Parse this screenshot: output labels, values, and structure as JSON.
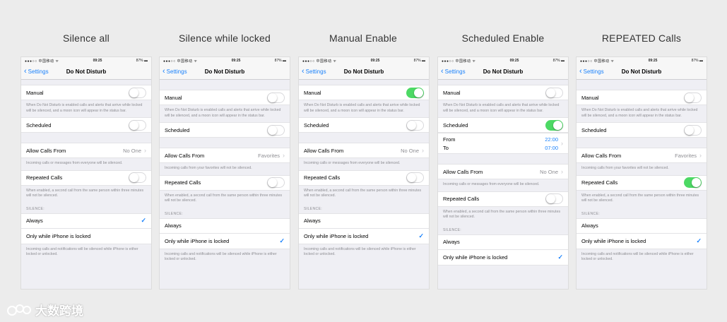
{
  "variants": [
    {
      "title": "Silence all"
    },
    {
      "title": "Silence while locked"
    },
    {
      "title": "Manual Enable"
    },
    {
      "title": "Scheduled Enable"
    },
    {
      "title": "REPEATED Calls"
    }
  ],
  "status_bar": {
    "carrier": "●●●○○ 中国移动 ᯤ",
    "time": "09:25",
    "battery": "87% ▬"
  },
  "nav": {
    "back_label": "Settings",
    "title": "Do Not Disturb"
  },
  "manual": {
    "label": "Manual",
    "note": "When Do Not Disturb is enabled calls and alerts that arrive while locked will be silenced, and a moon icon will appear in the status bar."
  },
  "scheduled": {
    "label": "Scheduled",
    "from_label": "From",
    "to_label": "To",
    "from_time": "22:00",
    "to_time": "07:00"
  },
  "allow_calls": {
    "label": "Allow Calls From",
    "value_no_one": "No One",
    "value_favorites": "Favorites",
    "note_everyone": "Incoming calls or messages from everyone will be silenced.",
    "note_favorites": "Incoming calls from your favorites will not be silenced."
  },
  "repeated": {
    "label": "Repeated Calls",
    "note": "When enabled, a second call from the same person within three minutes will not be silenced."
  },
  "silence": {
    "header": "SILENCE:",
    "always": "Always",
    "locked": "Only while iPhone is locked",
    "note": "Incoming calls and notifications will be silenced while iPhone is either locked or unlocked."
  },
  "watermark": "大数跨境",
  "colors": {
    "accent": "#1a82fb",
    "toggle_on": "#4cd964",
    "background": "#ececec"
  }
}
